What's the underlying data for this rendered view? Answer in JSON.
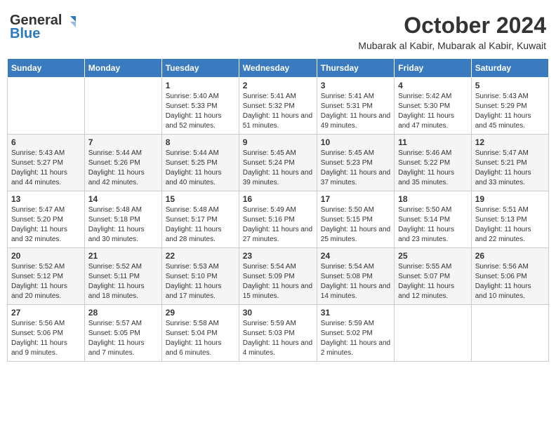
{
  "header": {
    "logo_general": "General",
    "logo_blue": "Blue",
    "month": "October 2024",
    "location": "Mubarak al Kabir, Mubarak al Kabir, Kuwait"
  },
  "days_of_week": [
    "Sunday",
    "Monday",
    "Tuesday",
    "Wednesday",
    "Thursday",
    "Friday",
    "Saturday"
  ],
  "weeks": [
    [
      {
        "day": "",
        "sunrise": "",
        "sunset": "",
        "daylight": ""
      },
      {
        "day": "",
        "sunrise": "",
        "sunset": "",
        "daylight": ""
      },
      {
        "day": "1",
        "sunrise": "Sunrise: 5:40 AM",
        "sunset": "Sunset: 5:33 PM",
        "daylight": "Daylight: 11 hours and 52 minutes."
      },
      {
        "day": "2",
        "sunrise": "Sunrise: 5:41 AM",
        "sunset": "Sunset: 5:32 PM",
        "daylight": "Daylight: 11 hours and 51 minutes."
      },
      {
        "day": "3",
        "sunrise": "Sunrise: 5:41 AM",
        "sunset": "Sunset: 5:31 PM",
        "daylight": "Daylight: 11 hours and 49 minutes."
      },
      {
        "day": "4",
        "sunrise": "Sunrise: 5:42 AM",
        "sunset": "Sunset: 5:30 PM",
        "daylight": "Daylight: 11 hours and 47 minutes."
      },
      {
        "day": "5",
        "sunrise": "Sunrise: 5:43 AM",
        "sunset": "Sunset: 5:29 PM",
        "daylight": "Daylight: 11 hours and 45 minutes."
      }
    ],
    [
      {
        "day": "6",
        "sunrise": "Sunrise: 5:43 AM",
        "sunset": "Sunset: 5:27 PM",
        "daylight": "Daylight: 11 hours and 44 minutes."
      },
      {
        "day": "7",
        "sunrise": "Sunrise: 5:44 AM",
        "sunset": "Sunset: 5:26 PM",
        "daylight": "Daylight: 11 hours and 42 minutes."
      },
      {
        "day": "8",
        "sunrise": "Sunrise: 5:44 AM",
        "sunset": "Sunset: 5:25 PM",
        "daylight": "Daylight: 11 hours and 40 minutes."
      },
      {
        "day": "9",
        "sunrise": "Sunrise: 5:45 AM",
        "sunset": "Sunset: 5:24 PM",
        "daylight": "Daylight: 11 hours and 39 minutes."
      },
      {
        "day": "10",
        "sunrise": "Sunrise: 5:45 AM",
        "sunset": "Sunset: 5:23 PM",
        "daylight": "Daylight: 11 hours and 37 minutes."
      },
      {
        "day": "11",
        "sunrise": "Sunrise: 5:46 AM",
        "sunset": "Sunset: 5:22 PM",
        "daylight": "Daylight: 11 hours and 35 minutes."
      },
      {
        "day": "12",
        "sunrise": "Sunrise: 5:47 AM",
        "sunset": "Sunset: 5:21 PM",
        "daylight": "Daylight: 11 hours and 33 minutes."
      }
    ],
    [
      {
        "day": "13",
        "sunrise": "Sunrise: 5:47 AM",
        "sunset": "Sunset: 5:20 PM",
        "daylight": "Daylight: 11 hours and 32 minutes."
      },
      {
        "day": "14",
        "sunrise": "Sunrise: 5:48 AM",
        "sunset": "Sunset: 5:18 PM",
        "daylight": "Daylight: 11 hours and 30 minutes."
      },
      {
        "day": "15",
        "sunrise": "Sunrise: 5:48 AM",
        "sunset": "Sunset: 5:17 PM",
        "daylight": "Daylight: 11 hours and 28 minutes."
      },
      {
        "day": "16",
        "sunrise": "Sunrise: 5:49 AM",
        "sunset": "Sunset: 5:16 PM",
        "daylight": "Daylight: 11 hours and 27 minutes."
      },
      {
        "day": "17",
        "sunrise": "Sunrise: 5:50 AM",
        "sunset": "Sunset: 5:15 PM",
        "daylight": "Daylight: 11 hours and 25 minutes."
      },
      {
        "day": "18",
        "sunrise": "Sunrise: 5:50 AM",
        "sunset": "Sunset: 5:14 PM",
        "daylight": "Daylight: 11 hours and 23 minutes."
      },
      {
        "day": "19",
        "sunrise": "Sunrise: 5:51 AM",
        "sunset": "Sunset: 5:13 PM",
        "daylight": "Daylight: 11 hours and 22 minutes."
      }
    ],
    [
      {
        "day": "20",
        "sunrise": "Sunrise: 5:52 AM",
        "sunset": "Sunset: 5:12 PM",
        "daylight": "Daylight: 11 hours and 20 minutes."
      },
      {
        "day": "21",
        "sunrise": "Sunrise: 5:52 AM",
        "sunset": "Sunset: 5:11 PM",
        "daylight": "Daylight: 11 hours and 18 minutes."
      },
      {
        "day": "22",
        "sunrise": "Sunrise: 5:53 AM",
        "sunset": "Sunset: 5:10 PM",
        "daylight": "Daylight: 11 hours and 17 minutes."
      },
      {
        "day": "23",
        "sunrise": "Sunrise: 5:54 AM",
        "sunset": "Sunset: 5:09 PM",
        "daylight": "Daylight: 11 hours and 15 minutes."
      },
      {
        "day": "24",
        "sunrise": "Sunrise: 5:54 AM",
        "sunset": "Sunset: 5:08 PM",
        "daylight": "Daylight: 11 hours and 14 minutes."
      },
      {
        "day": "25",
        "sunrise": "Sunrise: 5:55 AM",
        "sunset": "Sunset: 5:07 PM",
        "daylight": "Daylight: 11 hours and 12 minutes."
      },
      {
        "day": "26",
        "sunrise": "Sunrise: 5:56 AM",
        "sunset": "Sunset: 5:06 PM",
        "daylight": "Daylight: 11 hours and 10 minutes."
      }
    ],
    [
      {
        "day": "27",
        "sunrise": "Sunrise: 5:56 AM",
        "sunset": "Sunset: 5:06 PM",
        "daylight": "Daylight: 11 hours and 9 minutes."
      },
      {
        "day": "28",
        "sunrise": "Sunrise: 5:57 AM",
        "sunset": "Sunset: 5:05 PM",
        "daylight": "Daylight: 11 hours and 7 minutes."
      },
      {
        "day": "29",
        "sunrise": "Sunrise: 5:58 AM",
        "sunset": "Sunset: 5:04 PM",
        "daylight": "Daylight: 11 hours and 6 minutes."
      },
      {
        "day": "30",
        "sunrise": "Sunrise: 5:59 AM",
        "sunset": "Sunset: 5:03 PM",
        "daylight": "Daylight: 11 hours and 4 minutes."
      },
      {
        "day": "31",
        "sunrise": "Sunrise: 5:59 AM",
        "sunset": "Sunset: 5:02 PM",
        "daylight": "Daylight: 11 hours and 2 minutes."
      },
      {
        "day": "",
        "sunrise": "",
        "sunset": "",
        "daylight": ""
      },
      {
        "day": "",
        "sunrise": "",
        "sunset": "",
        "daylight": ""
      }
    ]
  ]
}
